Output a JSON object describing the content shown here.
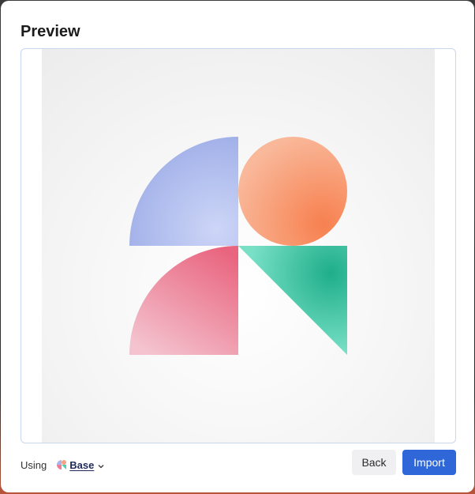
{
  "dialog": {
    "title": "Preview"
  },
  "footer": {
    "using_label": "Using",
    "base_label": "Base",
    "base_icon": "pinwheel-icon"
  },
  "buttons": {
    "back_label": "Back",
    "import_label": "Import"
  },
  "colors": {
    "accent": "#2f66d8",
    "quarter_blue": "#a7b6ec",
    "circle_orange": "#f9a07e",
    "quarter_pink": "#ec7d92",
    "triangle_teal": "#4fd0b0"
  }
}
